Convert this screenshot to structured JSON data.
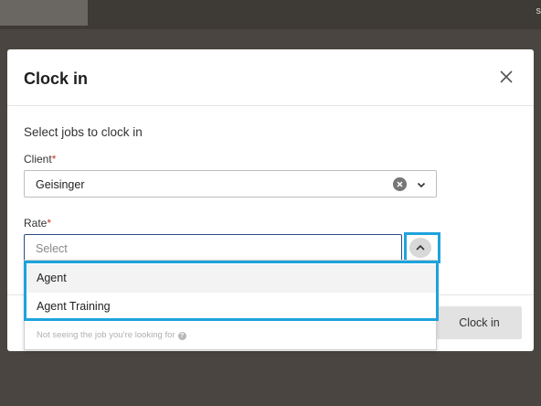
{
  "background": {
    "top_right_glyph": "s"
  },
  "modal": {
    "title": "Clock in",
    "section_heading": "Select jobs to clock in",
    "client": {
      "label": "Client",
      "required_mark": "*",
      "value": "Geisinger"
    },
    "rate": {
      "label": "Rate",
      "required_mark": "*",
      "placeholder": "Select"
    },
    "submit_label": "Clock in"
  },
  "dropdown": {
    "options": [
      {
        "label": "Agent"
      },
      {
        "label": "Agent Training"
      }
    ],
    "hint": "Not seeing the job you’re looking for",
    "help_glyph": "?"
  },
  "colors": {
    "highlight": "#1ea3dc",
    "focus_border": "#2d4a8a",
    "required": "#c0392b"
  }
}
